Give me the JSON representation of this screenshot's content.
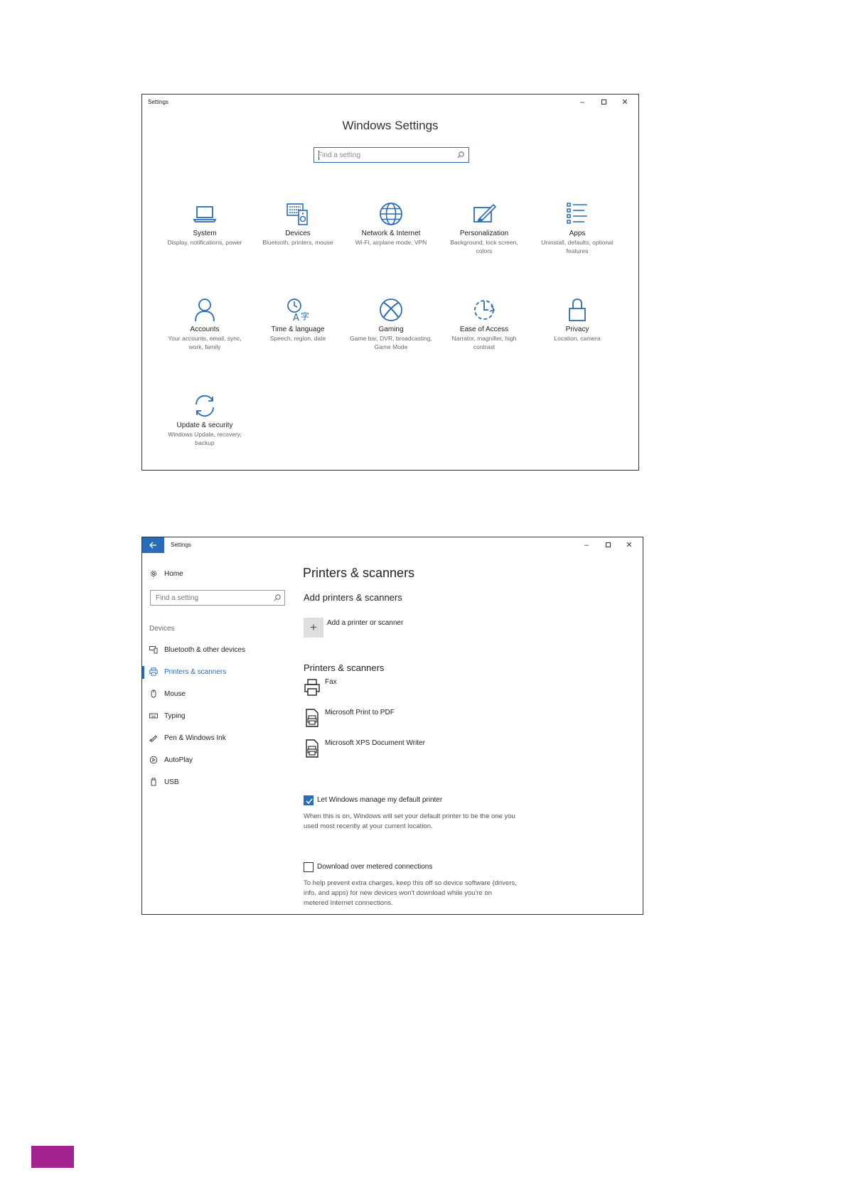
{
  "settings_window": {
    "title": "Settings",
    "heading": "Windows Settings",
    "search": {
      "placeholder": "Find a setting"
    },
    "tiles": [
      {
        "label": "System",
        "desc": "Display, notifications, power",
        "icon": "laptop-icon"
      },
      {
        "label": "Devices",
        "desc": "Bluetooth, printers, mouse",
        "icon": "devices-icon"
      },
      {
        "label": "Network & Internet",
        "desc": "Wi-Fi, airplane mode, VPN",
        "icon": "globe-icon"
      },
      {
        "label": "Personalization",
        "desc": "Background, lock screen, colors",
        "icon": "paintbrush-icon"
      },
      {
        "label": "Apps",
        "desc": "Uninstall, defaults, optional features",
        "icon": "list-icon"
      },
      {
        "label": "Accounts",
        "desc": "Your accounts, email, sync, work, family",
        "icon": "person-icon"
      },
      {
        "label": "Time & language",
        "desc": "Speech, region, date",
        "icon": "time-language-icon"
      },
      {
        "label": "Gaming",
        "desc": "Game bar, DVR, broadcasting, Game Mode",
        "icon": "xbox-icon"
      },
      {
        "label": "Ease of Access",
        "desc": "Narrator, magnifier, high contrast",
        "icon": "ease-of-access-icon"
      },
      {
        "label": "Privacy",
        "desc": "Location, camera",
        "icon": "lock-icon"
      },
      {
        "label": "Update & security",
        "desc": "Windows Update, recovery, backup",
        "icon": "sync-icon"
      }
    ]
  },
  "printers_window": {
    "title": "Settings",
    "nav": {
      "home": "Home",
      "search_placeholder": "Find a setting",
      "category": "Devices",
      "items": [
        {
          "label": "Bluetooth & other devices",
          "icon": "bluetooth-devices-icon"
        },
        {
          "label": "Printers & scanners",
          "icon": "printer-icon",
          "active": true
        },
        {
          "label": "Mouse",
          "icon": "mouse-icon"
        },
        {
          "label": "Typing",
          "icon": "keyboard-icon"
        },
        {
          "label": "Pen & Windows Ink",
          "icon": "pen-icon"
        },
        {
          "label": "AutoPlay",
          "icon": "autoplay-icon"
        },
        {
          "label": "USB",
          "icon": "usb-icon"
        }
      ]
    },
    "main": {
      "title": "Printers & scanners",
      "add_section": "Add printers & scanners",
      "add_button_label": "Add a printer or scanner",
      "list_section": "Printers & scanners",
      "printers": [
        {
          "name": "Fax",
          "icon": "fax-printer-icon"
        },
        {
          "name": "Microsoft Print to PDF",
          "icon": "document-printer-icon"
        },
        {
          "name": "Microsoft XPS Document Writer",
          "icon": "document-printer-icon"
        }
      ],
      "manage_default": {
        "label": "Let Windows manage my default printer",
        "checked": true,
        "help": "When this is on, Windows will set your default printer to be the one you used most recently at your current location."
      },
      "metered": {
        "label": "Download over metered connections",
        "checked": false,
        "help": "To help prevent extra charges, keep this off so device software (drivers, info, and apps) for new devices won't download while you're on metered Internet connections."
      }
    }
  },
  "colors": {
    "accent": "#2b6cb8",
    "page_tab": "#a3238e"
  }
}
